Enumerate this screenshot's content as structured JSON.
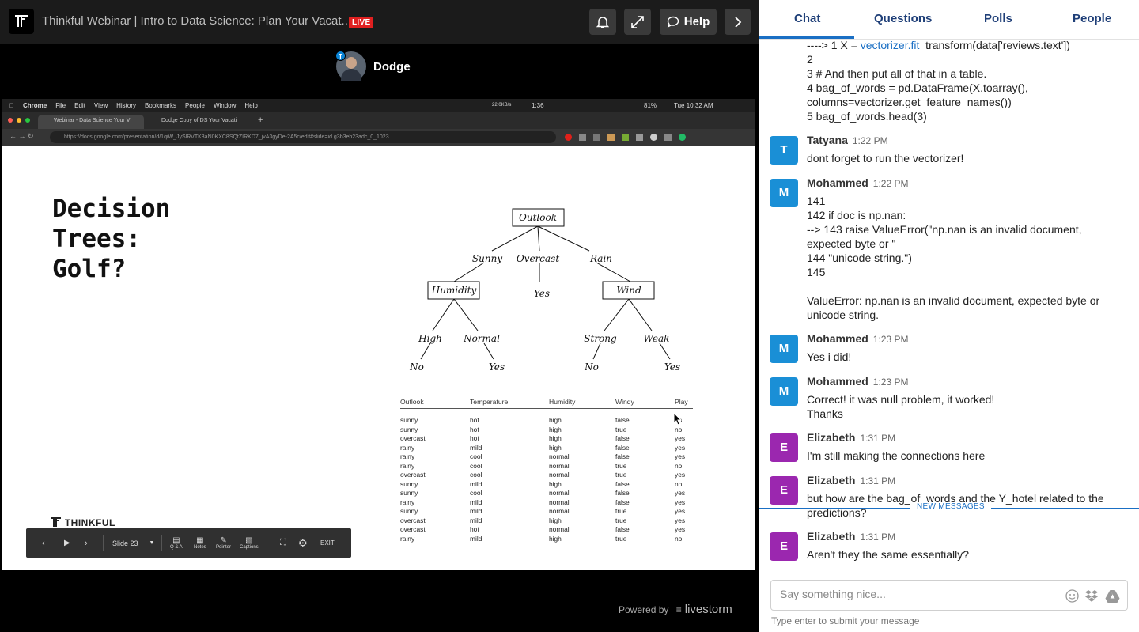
{
  "window": {
    "title": "Thinkful Webinar | Intro to Data Science: Plan Your Vacat...",
    "live_badge": "LIVE",
    "help_label": "Help"
  },
  "presenter": {
    "name": "Dodge",
    "badge": "T"
  },
  "shared_screen": {
    "menu": [
      "Chrome",
      "File",
      "Edit",
      "View",
      "History",
      "Bookmarks",
      "People",
      "Window",
      "Help"
    ],
    "status": {
      "battery": "81%",
      "clock": "Tue 10:32 AM",
      "timer": "1:36",
      "net": "22.0KB/s"
    },
    "tabs": [
      "Webinar - Data Science Your V",
      "Dodge Copy of DS Your Vacati"
    ],
    "url": "https://docs.google.com/presentation/d/1qiW_JySlRVTK3aN0KXC8SQtZIRKD7_jvA3gyDe-2A5c/edit#slide=id.g3b3eb23adc_0_1023",
    "slide": {
      "title_lines": [
        "Decision",
        "Trees:",
        "Golf?"
      ],
      "logo_text": "THINKFUL",
      "tree": {
        "root": "Outlook",
        "branches": [
          "Sunny",
          "Overcast",
          "Rain"
        ],
        "humidity": "Humidity",
        "wind": "Wind",
        "overcast_leaf": "Yes",
        "humidity_branches": [
          "High",
          "Normal"
        ],
        "humidity_leaves": [
          "No",
          "Yes"
        ],
        "wind_branches": [
          "Strong",
          "Weak"
        ],
        "wind_leaves": [
          "No",
          "Yes"
        ]
      },
      "table": {
        "columns": [
          "Outlook",
          "Temperature",
          "Humidity",
          "Windy",
          "Play"
        ],
        "rows": [
          [
            "sunny",
            "hot",
            "high",
            "false",
            "no"
          ],
          [
            "sunny",
            "hot",
            "high",
            "true",
            "no"
          ],
          [
            "overcast",
            "hot",
            "high",
            "false",
            "yes"
          ],
          [
            "rainy",
            "mild",
            "high",
            "false",
            "yes"
          ],
          [
            "rainy",
            "cool",
            "normal",
            "false",
            "yes"
          ],
          [
            "rainy",
            "cool",
            "normal",
            "true",
            "no"
          ],
          [
            "overcast",
            "cool",
            "normal",
            "true",
            "yes"
          ],
          [
            "sunny",
            "mild",
            "high",
            "false",
            "no"
          ],
          [
            "sunny",
            "cool",
            "normal",
            "false",
            "yes"
          ],
          [
            "rainy",
            "mild",
            "normal",
            "false",
            "yes"
          ],
          [
            "sunny",
            "mild",
            "normal",
            "true",
            "yes"
          ],
          [
            "overcast",
            "mild",
            "high",
            "true",
            "yes"
          ],
          [
            "overcast",
            "hot",
            "normal",
            "false",
            "yes"
          ],
          [
            "rainy",
            "mild",
            "high",
            "true",
            "no"
          ]
        ]
      },
      "controls": {
        "slide_label": "Slide 23",
        "qa": "Q & A",
        "notes": "Notes",
        "pointer": "Pointer",
        "captions": "Captions",
        "exit": "EXIT"
      }
    }
  },
  "powered_by": {
    "label": "Powered by",
    "brand": "livestorm"
  },
  "panel": {
    "tabs": [
      "Chat",
      "Questions",
      "Polls",
      "People"
    ],
    "active_tab": "Chat"
  },
  "chat": {
    "code_cont": {
      "line1_prefix": "----> 1 X = ",
      "line1_link": "vectorizer.fit",
      "line1_suffix": "_transform(data['reviews.text'])",
      "rest": [
        "2",
        "3 # And then put all of that in a table.",
        "4 bag_of_words = pd.DataFrame(X.toarray(),",
        "columns=vectorizer.get_feature_names())",
        "5 bag_of_words.head(3)"
      ]
    },
    "messages": [
      {
        "initial": "T",
        "name": "Tatyana",
        "time": "1:22 PM",
        "color": "#1a8fd6",
        "lines": [
          "dont forget to run the vectorizer!"
        ]
      },
      {
        "initial": "M",
        "name": "Mohammed",
        "time": "1:22 PM",
        "color": "#1a8fd6",
        "lines": [
          "141",
          "142 if doc is np.nan:",
          "--> 143 raise ValueError(\"np.nan is an invalid document,",
          "expected byte or \"",
          "144 \"unicode string.\")",
          "145",
          "",
          "ValueError: np.nan is an invalid document, expected byte or",
          "unicode string."
        ]
      },
      {
        "initial": "M",
        "name": "Mohammed",
        "time": "1:23 PM",
        "color": "#1a8fd6",
        "lines": [
          "Yes i did!"
        ]
      },
      {
        "initial": "M",
        "name": "Mohammed",
        "time": "1:23 PM",
        "color": "#1a8fd6",
        "lines": [
          "Correct! it was null problem, it worked!",
          "Thanks"
        ]
      },
      {
        "initial": "E",
        "name": "Elizabeth",
        "time": "1:31 PM",
        "color": "#9b27af",
        "lines": [
          "I'm still making the connections here"
        ]
      },
      {
        "initial": "E",
        "name": "Elizabeth",
        "time": "1:31 PM",
        "color": "#9b27af",
        "lines": [
          "but how are the bag_of_words and the Y_hotel related to the",
          "predictions?"
        ]
      },
      {
        "initial": "E",
        "name": "Elizabeth",
        "time": "1:31 PM",
        "color": "#9b27af",
        "lines": [
          "Aren't they the same essentially?"
        ]
      }
    ],
    "new_messages_label": "NEW MESSAGES",
    "input_placeholder": "Say something nice...",
    "hint": "Type enter to submit your message"
  },
  "colors": {
    "accent": "#1a6fc4",
    "live": "#e02020",
    "avatar_blue": "#1a8fd6",
    "avatar_purple": "#9b27af"
  }
}
